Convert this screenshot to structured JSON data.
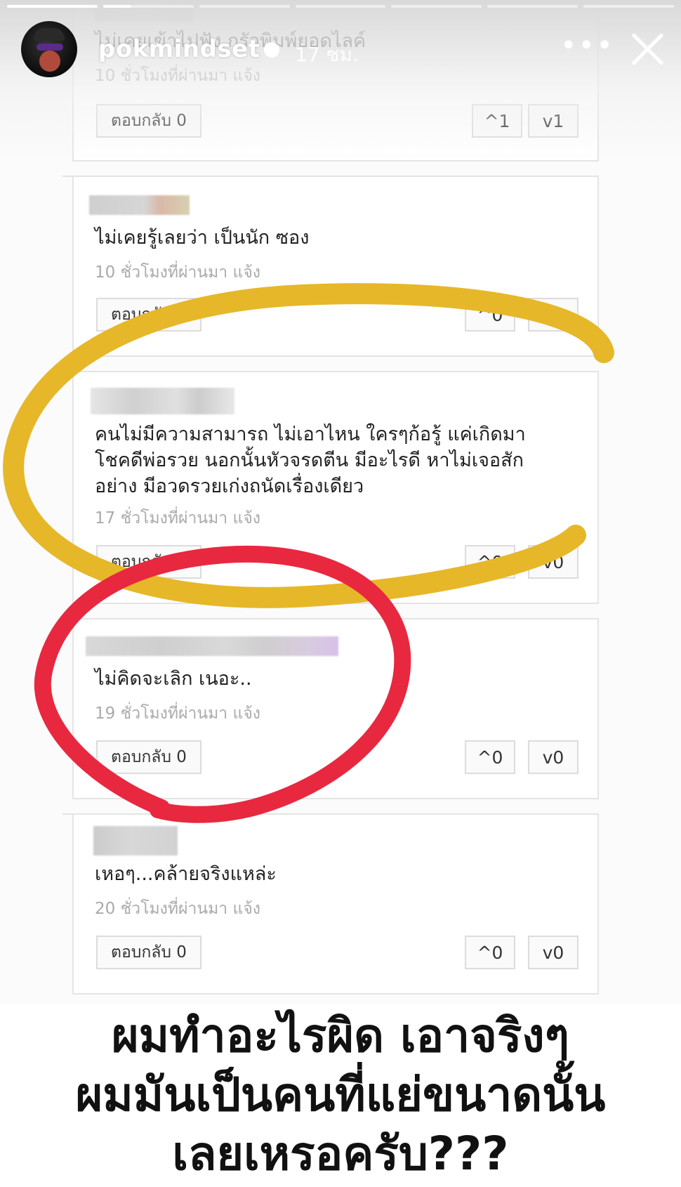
{
  "story": {
    "username": "pokmindset",
    "time": "17 ชม.",
    "segments": [
      1,
      0.3,
      0,
      0,
      0,
      0,
      0
    ],
    "more_icon": "•••"
  },
  "comments": [
    {
      "text": "ไม่เคยเข้าไปฟัง กรัวพิมพ์ยอดไลค์",
      "time": "10 ชั่วโมงที่ผ่านมา  แจ้ง",
      "reply": "ตอบกลับ 0",
      "up": "^1",
      "down": "v1"
    },
    {
      "text": "ไม่เคยรู้เลยว่า เป็นนัก ซอง",
      "time": "10 ชั่วโมงที่ผ่านมา  แจ้ง",
      "reply": "ตอบกลับ 0",
      "up": "^0",
      "down": "v0"
    },
    {
      "text_lines": [
        "คนไม่มีความสามารถ ไม่เอาไหน ใครๆก้อรู้ แค่เกิดมา",
        "โชคดีพ่อรวย นอกนั้นหัวจรดตีน มีอะไรดี หาไม่เจอสัก",
        "อย่าง มีอวดรวยเก่งถนัดเรื่องเดียว"
      ],
      "time": "17 ชั่วโมงที่ผ่านมา  แจ้ง",
      "reply": "ตอบกลับ 0",
      "up": "^0",
      "down": "v0"
    },
    {
      "text": "ไม่คิดจะเลิก เนอะ..",
      "time": "19 ชั่วโมงที่ผ่านมา  แจ้ง",
      "reply": "ตอบกลับ 0",
      "up": "^0",
      "down": "v0"
    },
    {
      "text": "เหอๆ...คล้ายจริงแหล่ะ",
      "time": "20 ชั่วโมงที่ผ่านมา  แจ้ง",
      "reply": "ตอบกลับ 0",
      "up": "^0",
      "down": "v0"
    }
  ],
  "caption": {
    "line1": "ผมทำอะไรผิด  เอาจริงๆ",
    "line2": "ผมมันเป็นคนที่แย่ขนาดนั้น",
    "line3": "เลยเหรอครับ???"
  },
  "colors": {
    "yellow_scribble": "#e6b729",
    "red_scribble": "#e8283f"
  }
}
